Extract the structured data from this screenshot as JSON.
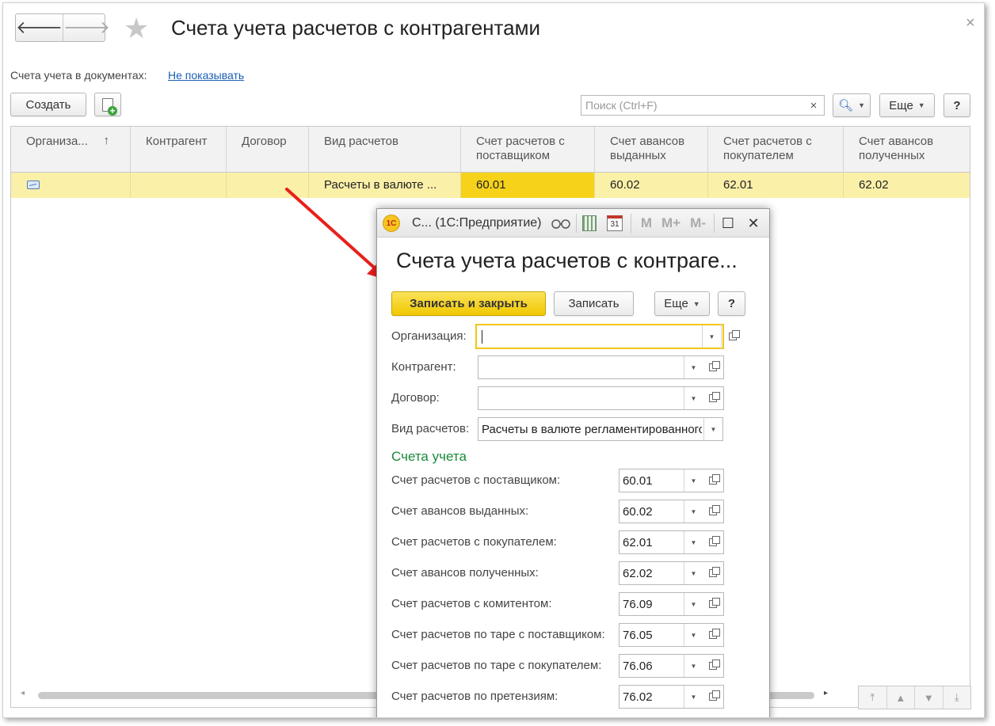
{
  "window": {
    "back_glyph": "🡐",
    "forward_glyph": "🡒",
    "star_glyph": "★",
    "title": "Счета учета расчетов с контрагентами",
    "close_glyph": "×"
  },
  "accounts_in_docs": {
    "label": "Счета учета в документах:",
    "link": "Не показывать"
  },
  "toolbar": {
    "create_label": "Создать",
    "search_placeholder": "Поиск (Ctrl+F)",
    "search_clear": "×",
    "search_icon": "🔍︎",
    "more_label": "Еще",
    "help_label": "?"
  },
  "table": {
    "columns": [
      "Организа...",
      "Контрагент",
      "Договор",
      "Вид расчетов",
      "Счет расчетов с поставщиком",
      "Счет авансов выданных",
      "Счет расчетов с покупателем",
      "Счет авансов полученных"
    ],
    "sort_glyph": "↑",
    "rows": [
      {
        "organization": "",
        "counterparty": "",
        "contract": "",
        "settlement_type": "Расчеты в валюте ...",
        "supplier_account": "60.01",
        "advances_issued": "60.02",
        "customer_account": "62.01",
        "advances_received": "62.02"
      }
    ],
    "scroll_left": "◂",
    "scroll_right": "▸",
    "nav_glyphs": [
      "⤒",
      "▲",
      "▼",
      "⤓"
    ]
  },
  "dialog": {
    "logo": "1С",
    "window_title": "С...  (1С:Предприятие)",
    "heading": "Счета учета расчетов с контраге...",
    "save_close_label": "Записать и закрыть",
    "save_label": "Записать",
    "more_label": "Еще",
    "help_label": "?",
    "calendar_day": "31",
    "mem_labels": [
      "M",
      "M+",
      "M-"
    ],
    "maximize_glyph": "☐",
    "close_glyph": "✕",
    "fields": {
      "organization_label": "Организация:",
      "organization_value": "",
      "counterparty_label": "Контрагент:",
      "counterparty_value": "",
      "contract_label": "Договор:",
      "contract_value": "",
      "settlement_type_label": "Вид расчетов:",
      "settlement_type_value": "Расчеты в валюте регламентированного у"
    },
    "accounts_section_title": "Счета учета",
    "accounts": [
      {
        "label": "Счет расчетов с поставщиком:",
        "value": "60.01"
      },
      {
        "label": "Счет авансов выданных:",
        "value": "60.02"
      },
      {
        "label": "Счет расчетов с покупателем:",
        "value": "62.01"
      },
      {
        "label": "Счет авансов полученных:",
        "value": "62.02"
      },
      {
        "label": "Счет расчетов с комитентом:",
        "value": "76.09"
      },
      {
        "label": "Счет расчетов по таре с поставщиком:",
        "value": "76.05"
      },
      {
        "label": "Счет расчетов по таре с покупателем:",
        "value": "76.06"
      },
      {
        "label": "Счет расчетов по претензиям:",
        "value": "76.02"
      }
    ]
  },
  "colors": {
    "selected_row": "#fbf0a8",
    "active_cell": "#f6d21a",
    "primary_button": "#f0c800",
    "section_title": "#1b8a3a",
    "link": "#1a5fb4",
    "annotation_arrow": "#e8201c"
  }
}
